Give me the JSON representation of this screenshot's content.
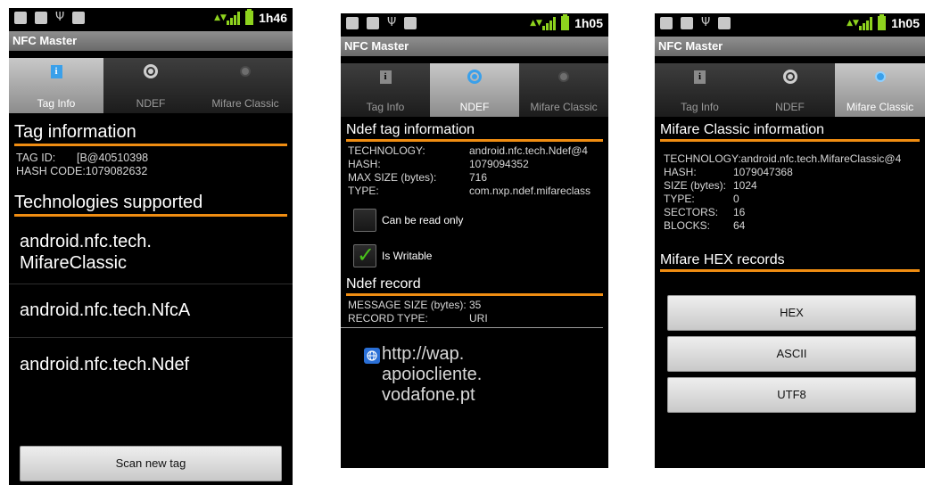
{
  "status": {
    "clocks": [
      "1h46",
      "1h05",
      "1h05"
    ]
  },
  "app_title": "NFC Master",
  "tabs": [
    "Tag Info",
    "NDEF",
    "Mifare Classic"
  ],
  "icons": {
    "tab_info": "info-icon",
    "tab_ndef": "ndef-target-icon",
    "tab_mifare": "mifare-disc-icon",
    "record_uri": "globe-icon"
  },
  "colors": {
    "accent": "#f08d12",
    "active_tab_icon": "#3aa0ea",
    "check": "#49c21b"
  },
  "screen1": {
    "section_tag": "Tag information",
    "tag_id_label": "TAG ID:",
    "tag_id_value": "[B@40510398",
    "hash_code": "HASH CODE:1079082632",
    "section_tech": "Technologies supported",
    "technologies": [
      "android.nfc.tech.\nMifareClassic",
      "android.nfc.tech.NfcA",
      "android.nfc.tech.Ndef"
    ],
    "scan_button": "Scan new tag"
  },
  "screen2": {
    "section_ndef": "Ndef tag information",
    "fields": [
      {
        "label": "TECHNOLOGY:",
        "value": "android.nfc.tech.Ndef@4"
      },
      {
        "label": "HASH:",
        "value": "1079094352"
      },
      {
        "label": "MAX SIZE (bytes):",
        "value": "716"
      },
      {
        "label": "TYPE:",
        "value": "com.nxp.ndef.mifareclass"
      }
    ],
    "cb_read_only": "Can be read only",
    "cb_writable": "Is Writable",
    "cb_read_only_checked": false,
    "cb_writable_checked": true,
    "section_record": "Ndef record",
    "record_fields": [
      {
        "label": "MESSAGE SIZE (bytes):",
        "value": "35"
      },
      {
        "label": "RECORD TYPE:",
        "value": "URI"
      }
    ],
    "uri": "http://wap.\napoiocliente.\nvodafone.pt"
  },
  "screen3": {
    "section_mifare": "Mifare Classic information",
    "technology": "TECHNOLOGY:android.nfc.tech.MifareClassic@4",
    "fields": [
      {
        "label": "HASH:",
        "value": "1079047368"
      },
      {
        "label": "SIZE (bytes):",
        "value": "1024"
      },
      {
        "label": "TYPE:",
        "value": "0"
      },
      {
        "label": "SECTORS:",
        "value": "16"
      },
      {
        "label": "BLOCKS:",
        "value": "64"
      }
    ],
    "section_hex": "Mifare HEX records",
    "buttons": [
      "HEX",
      "ASCII",
      "UTF8"
    ]
  }
}
